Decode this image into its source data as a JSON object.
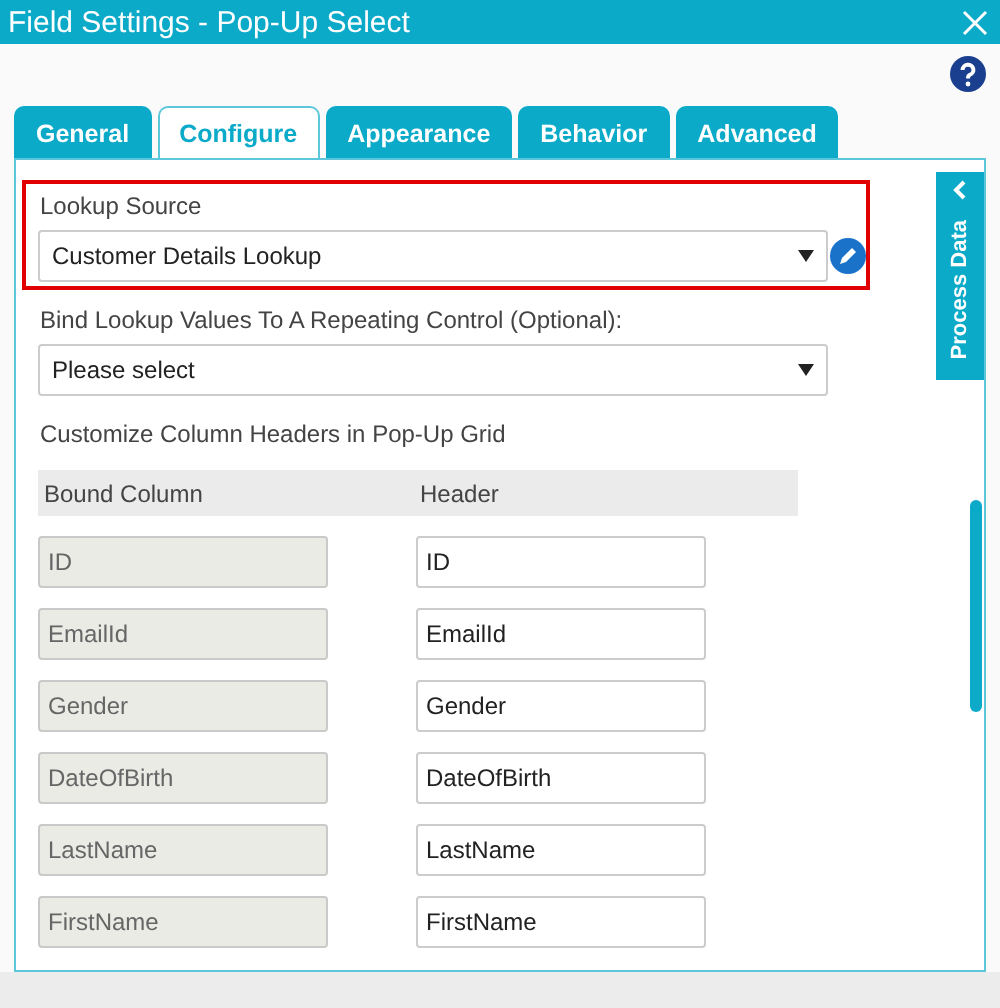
{
  "window": {
    "title": "Field Settings - Pop-Up Select"
  },
  "tabs": [
    {
      "label": "General",
      "selected": false
    },
    {
      "label": "Configure",
      "selected": true
    },
    {
      "label": "Appearance",
      "selected": false
    },
    {
      "label": "Behavior",
      "selected": false
    },
    {
      "label": "Advanced",
      "selected": false
    }
  ],
  "lookup_source": {
    "label": "Lookup Source",
    "value": "Customer Details Lookup",
    "highlighted": true
  },
  "bind_lookup": {
    "label": "Bind Lookup Values To A Repeating Control (Optional):",
    "value": "Please select"
  },
  "column_headers": {
    "title": "Customize Column Headers in Pop-Up Grid",
    "columns": [
      "Bound Column",
      "Header"
    ],
    "rows": [
      {
        "bound": "ID",
        "header": "ID"
      },
      {
        "bound": "EmailId",
        "header": "EmailId"
      },
      {
        "bound": "Gender",
        "header": "Gender"
      },
      {
        "bound": "DateOfBirth",
        "header": "DateOfBirth"
      },
      {
        "bound": "LastName",
        "header": "LastName"
      },
      {
        "bound": "FirstName",
        "header": "FirstName"
      }
    ]
  },
  "side_panel": {
    "label": "Process Data"
  }
}
